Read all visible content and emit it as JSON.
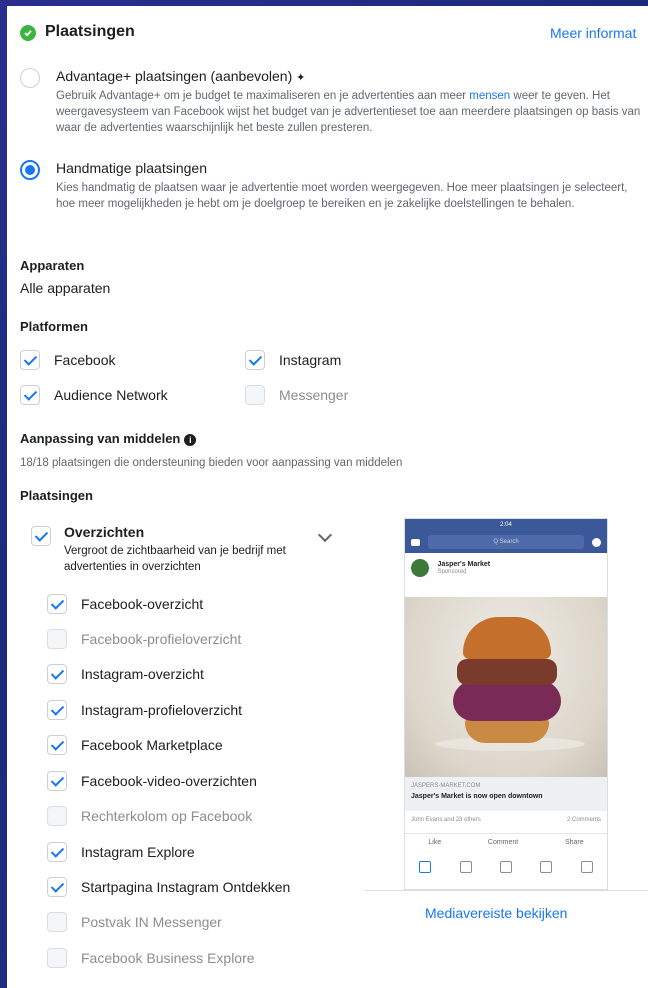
{
  "header": {
    "title": "Plaatsingen",
    "more_link": "Meer informat"
  },
  "advantage": {
    "title": "Advantage+ plaatsingen (aanbevolen)",
    "desc_part1": "Gebruik Advantage+ om je budget te maximaliseren en je advertenties aan meer ",
    "desc_link": "mensen",
    "desc_part2": " weer te geven. Het weergavesysteem van Facebook wijst het budget van je advertentieset toe aan meerdere plaatsingen op basis van waar de advertenties waarschijnlijk het beste zullen presteren.",
    "selected": false
  },
  "manual": {
    "title": "Handmatige plaatsingen",
    "desc": "Kies handmatig de plaatsen waar je advertentie moet worden weergegeven. Hoe meer plaatsingen je selecteert, hoe meer mogelijkheden je hebt om je doelgroep te bereiken en je zakelijke doelstellingen te behalen.",
    "selected": true
  },
  "devices": {
    "heading": "Apparaten",
    "value": "Alle apparaten"
  },
  "platforms": {
    "heading": "Platformen",
    "items": [
      {
        "label": "Facebook",
        "checked": true
      },
      {
        "label": "Instagram",
        "checked": true
      },
      {
        "label": "Audience Network",
        "checked": true
      },
      {
        "label": "Messenger",
        "checked": false
      }
    ]
  },
  "asset": {
    "heading": "Aanpassing van middelen",
    "info_icon": "i",
    "text": "18/18 plaatsingen die ondersteuning bieden voor aanpassing van middelen"
  },
  "placements": {
    "heading": "Plaatsingen",
    "group_title": "Overzichten",
    "group_desc": "Vergroot de zichtbaarheid van je bedrijf met advertenties in overzichten",
    "items": [
      {
        "label": "Facebook-overzicht",
        "checked": true
      },
      {
        "label": "Facebook-profieloverzicht",
        "checked": false
      },
      {
        "label": "Instagram-overzicht",
        "checked": true
      },
      {
        "label": "Instagram-profieloverzicht",
        "checked": true
      },
      {
        "label": "Facebook Marketplace",
        "checked": true
      },
      {
        "label": "Facebook-video-overzichten",
        "checked": true
      },
      {
        "label": "Rechterkolom op Facebook",
        "checked": false
      },
      {
        "label": "Instagram Explore",
        "checked": true
      },
      {
        "label": "Startpagina Instagram Ontdekken",
        "checked": true
      },
      {
        "label": "Postvak IN Messenger",
        "checked": false
      },
      {
        "label": "Facebook Business Explore",
        "checked": false
      }
    ]
  },
  "preview": {
    "time": "2:04",
    "search": "Q Search",
    "page_name": "Jasper's Market",
    "sponsored": "Sponsored",
    "url": "JASPERS-MARKET.COM",
    "headline": "Jasper's Market is now open downtown",
    "reactions": "John Evans and 23 others",
    "comments": "2 Comments",
    "like": "Like",
    "comment": "Comment",
    "share": "Share",
    "link": "Mediavereiste bekijken"
  },
  "colors": {
    "accent": "#1877f2",
    "success": "#3eb342",
    "fb_blue": "#3b5998"
  }
}
